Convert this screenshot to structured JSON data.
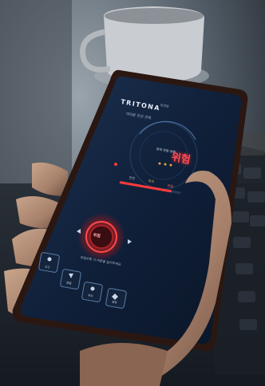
{
  "app": {
    "brand": "TRITONA",
    "brand_sub": "모바일",
    "status_text": "여러분 안전 관제",
    "risk_caption": "현재 위험 레벨",
    "risk_level": "위험",
    "scale_labels": [
      "안전",
      "주의",
      "위험"
    ],
    "risk_fraction": 0.85,
    "center_button_label": "위험",
    "guide_text": "위험상황 시 버튼을 눌러주세요",
    "bottom_buttons": [
      "신고",
      "알림",
      "위치",
      "설정"
    ]
  },
  "colors": {
    "accent_red": "#ff3b3b",
    "warn_orange": "#e9a23b",
    "screen_bg": "#0f1e34",
    "frame": "#2b1712"
  }
}
